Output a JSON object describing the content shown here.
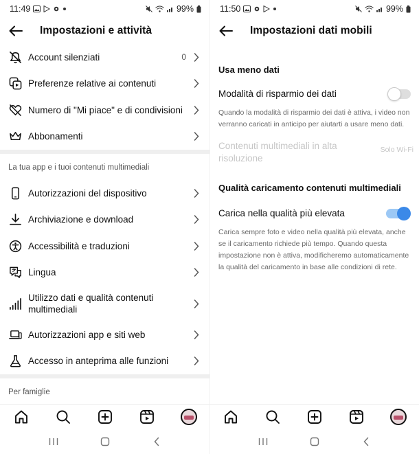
{
  "left": {
    "status": {
      "time": "11:49",
      "battery": "99%"
    },
    "header": {
      "title": "Impostazioni e attività"
    },
    "items_top": [
      {
        "name": "account-silenziati",
        "label": "Account silenziati",
        "count": "0",
        "icon": "muted-bell-icon"
      },
      {
        "name": "preferenze-contenuti",
        "label": "Preferenze relative ai contenuti",
        "icon": "content-preferences-icon"
      },
      {
        "name": "numero-mi-piace",
        "label": "Numero di \"Mi piace\" e di condivisioni",
        "icon": "heart-slash-icon"
      },
      {
        "name": "abbonamenti",
        "label": "Abbonamenti",
        "icon": "crown-icon"
      }
    ],
    "section_app": "La tua app e i tuoi contenuti multimediali",
    "items_app": [
      {
        "label": "Autorizzazioni del dispositivo",
        "icon": "phone-icon"
      },
      {
        "label": "Archiviazione e download",
        "icon": "download-icon"
      },
      {
        "label": "Accessibilità e traduzioni",
        "icon": "accessibility-icon"
      },
      {
        "label": "Lingua",
        "icon": "language-icon"
      },
      {
        "label": "Utilizzo dati e qualità contenuti multimediali",
        "icon": "signal-bars-icon"
      },
      {
        "label": "Autorizzazioni app e siti web",
        "icon": "laptop-icon"
      },
      {
        "label": "Accesso in anteprima alle funzioni",
        "icon": "flask-icon"
      }
    ],
    "section_family": "Per famiglie"
  },
  "right": {
    "status": {
      "time": "11:50",
      "battery": "99%"
    },
    "header": {
      "title": "Impostazioni dati mobili"
    },
    "section_less_data": "Usa meno dati",
    "data_saver": {
      "label": "Modalità di risparmio dei dati",
      "enabled": false
    },
    "data_saver_desc": "Quando la modalità di risparmio dei dati è attiva, i video non verranno caricati in anticipo per aiutarti a usare meno dati.",
    "hi_res": {
      "label": "Contenuti multimediali in alta risoluzione",
      "value": "Solo Wi-Fi"
    },
    "section_upload": "Qualità caricamento contenuti multimediali",
    "upload_hq": {
      "label": "Carica nella qualità più elevata",
      "enabled": true
    },
    "upload_hq_desc": "Carica sempre foto e video nella qualità più elevata, anche se il caricamento richiede più tempo. Quando questa impostazione non è attiva, modificheremo automaticamente la qualità del caricamento in base alle condizioni di rete."
  },
  "colors": {
    "accent": "#3b89e8",
    "accent_track": "#9cc8f5",
    "divider": "#efefef",
    "muted": "#c6c6c6"
  }
}
